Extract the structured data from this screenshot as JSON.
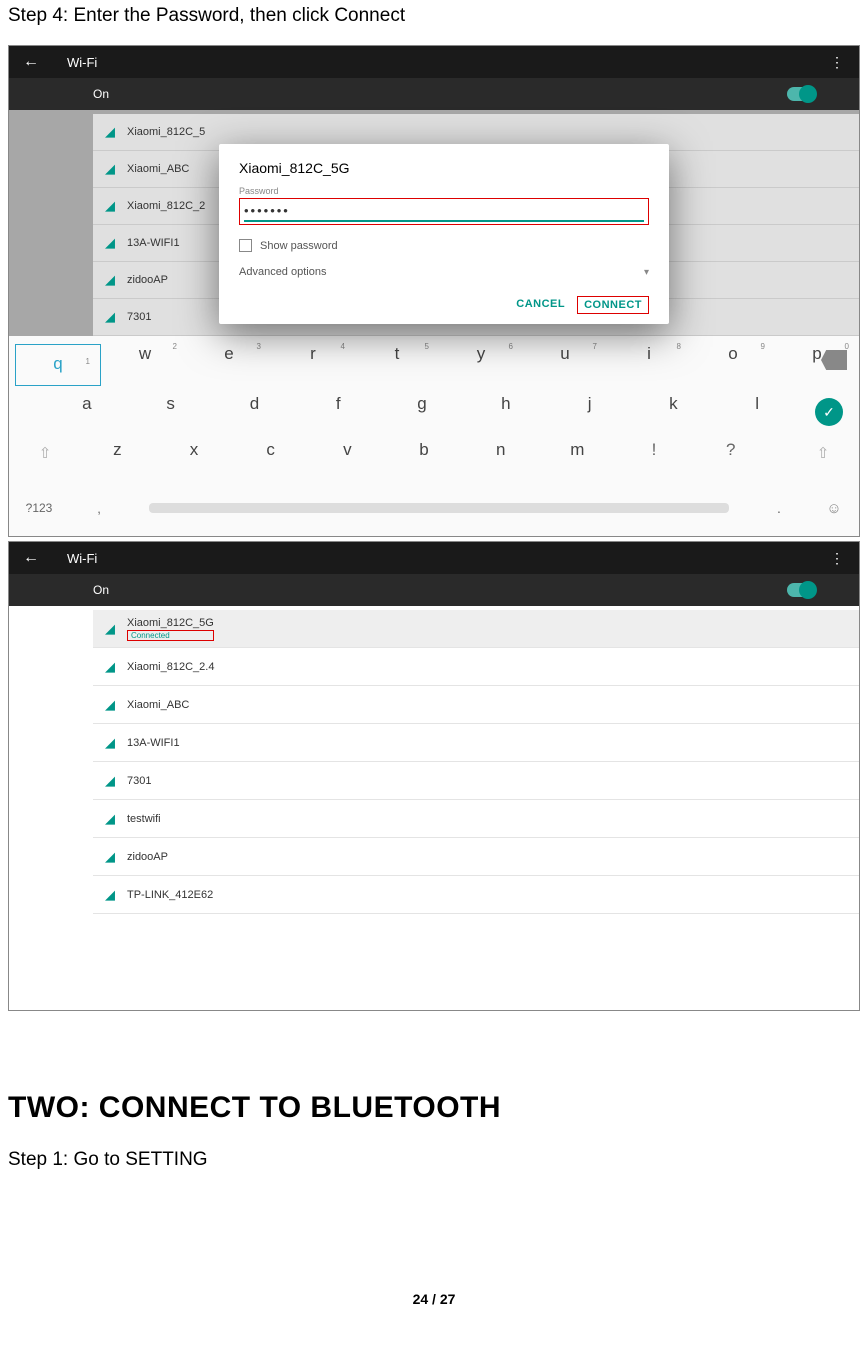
{
  "doc": {
    "step4_title": "Step 4: Enter the Password, then click Connect",
    "section2_heading": "TWO: CONNECT TO BLUETOOTH",
    "step1_sub": "Step 1: Go to SETTING",
    "page_current": "24",
    "page_sep": " / ",
    "page_total": "27"
  },
  "shot1": {
    "header": {
      "back": "←",
      "title": "Wi-Fi",
      "menu": "⋮"
    },
    "onbar": {
      "label": "On"
    },
    "dimmed_networks": [
      "Xiaomi_812C_5",
      "Xiaomi_ABC",
      "Xiaomi_812C_2",
      "13A-WIFI1",
      "zidooAP",
      "7301"
    ],
    "dialog": {
      "title": "Xiaomi_812C_5G",
      "pw_label": "Password",
      "pw_value": "•••••••",
      "show_pw": "Show password",
      "advanced": "Advanced options",
      "cancel": "CANCEL",
      "connect": "CONNECT"
    },
    "keyboard": {
      "row1": [
        [
          "q",
          "1"
        ],
        [
          "w",
          "2"
        ],
        [
          "e",
          "3"
        ],
        [
          "r",
          "4"
        ],
        [
          "t",
          "5"
        ],
        [
          "y",
          "6"
        ],
        [
          "u",
          "7"
        ],
        [
          "i",
          "8"
        ],
        [
          "o",
          "9"
        ],
        [
          "p",
          "0"
        ]
      ],
      "row2": [
        "a",
        "s",
        "d",
        "f",
        "g",
        "h",
        "j",
        "k",
        "l"
      ],
      "row3": [
        "z",
        "x",
        "c",
        "v",
        "b",
        "n",
        "m",
        "!",
        "?"
      ],
      "sym": "?123",
      "comma": ",",
      "dot": ".",
      "emoji": "☺"
    }
  },
  "shot2": {
    "header": {
      "back": "←",
      "title": "Wi-Fi",
      "menu": "⋮"
    },
    "onbar": {
      "label": "On"
    },
    "networks": [
      {
        "name": "Xiaomi_812C_5G",
        "status": "Connected"
      },
      {
        "name": "Xiaomi_812C_2.4"
      },
      {
        "name": "Xiaomi_ABC"
      },
      {
        "name": "13A-WIFI1"
      },
      {
        "name": "7301"
      },
      {
        "name": "testwifi"
      },
      {
        "name": "zidooAP"
      },
      {
        "name": "TP-LINK_412E62"
      }
    ]
  }
}
